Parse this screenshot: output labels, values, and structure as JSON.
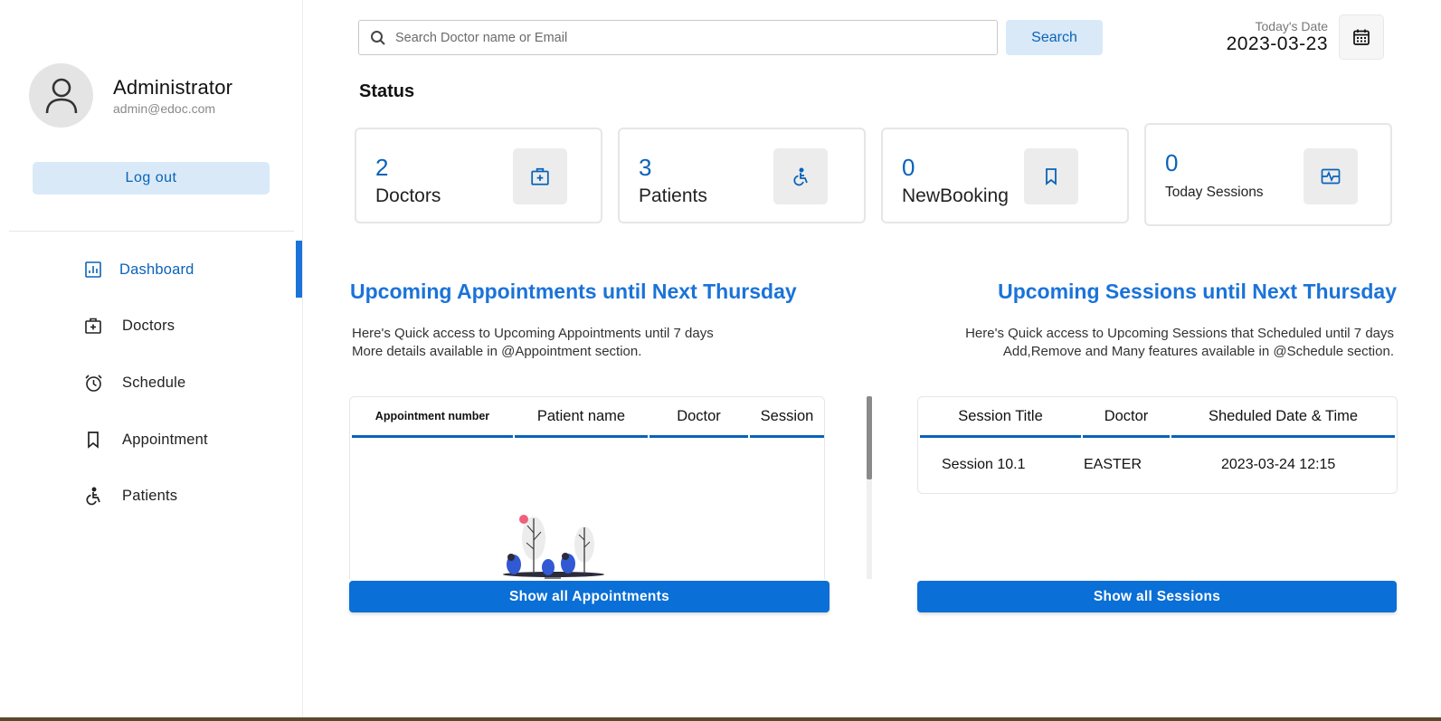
{
  "sidebar": {
    "profile": {
      "name": "Administrator",
      "email": "admin@edoc.com"
    },
    "logout_label": "Log out",
    "items": [
      {
        "label": "Dashboard",
        "icon": "dashboard-icon",
        "active": true
      },
      {
        "label": "Doctors",
        "icon": "medical-bag-icon"
      },
      {
        "label": "Schedule",
        "icon": "alarm-clock-icon"
      },
      {
        "label": "Appointment",
        "icon": "bookmark-icon"
      },
      {
        "label": "Patients",
        "icon": "wheelchair-icon"
      }
    ]
  },
  "header": {
    "search_placeholder": "Search Doctor name or Email",
    "search_button": "Search",
    "date_label": "Today's Date",
    "date_value": "2023-03-23"
  },
  "status": {
    "heading": "Status",
    "cards": [
      {
        "value": "2",
        "label": "Doctors",
        "icon": "medical-bag-icon"
      },
      {
        "value": "3",
        "label": "Patients",
        "icon": "wheelchair-icon"
      },
      {
        "value": "0",
        "label": "NewBooking",
        "icon": "bookmark-icon"
      },
      {
        "value": "0",
        "label": "Today Sessions",
        "icon": "session-icon"
      }
    ]
  },
  "appointments": {
    "title": "Upcoming Appointments until Next Thursday",
    "desc_line1": "Here's Quick access to Upcoming Appointments until 7 days",
    "desc_line2": "More details available in @Appointment section.",
    "columns": [
      "Appointment number",
      "Patient name",
      "Doctor",
      "Session"
    ],
    "button": "Show all Appointments"
  },
  "sessions": {
    "title": "Upcoming Sessions until Next Thursday",
    "desc_line1": "Here's Quick access to Upcoming Sessions that Scheduled until 7 days",
    "desc_line2": "Add,Remove and Many features available in @Schedule section.",
    "columns": [
      "Session Title",
      "Doctor",
      "Sheduled Date & Time"
    ],
    "rows": [
      {
        "title": "Session 10.1",
        "doctor": "EASTER",
        "datetime": "2023-03-24 12:15"
      }
    ],
    "button": "Show all Sessions"
  },
  "colors": {
    "accent": "#0a63b8",
    "button": "#0a6fd6",
    "light_accent": "#d9e9f8"
  }
}
